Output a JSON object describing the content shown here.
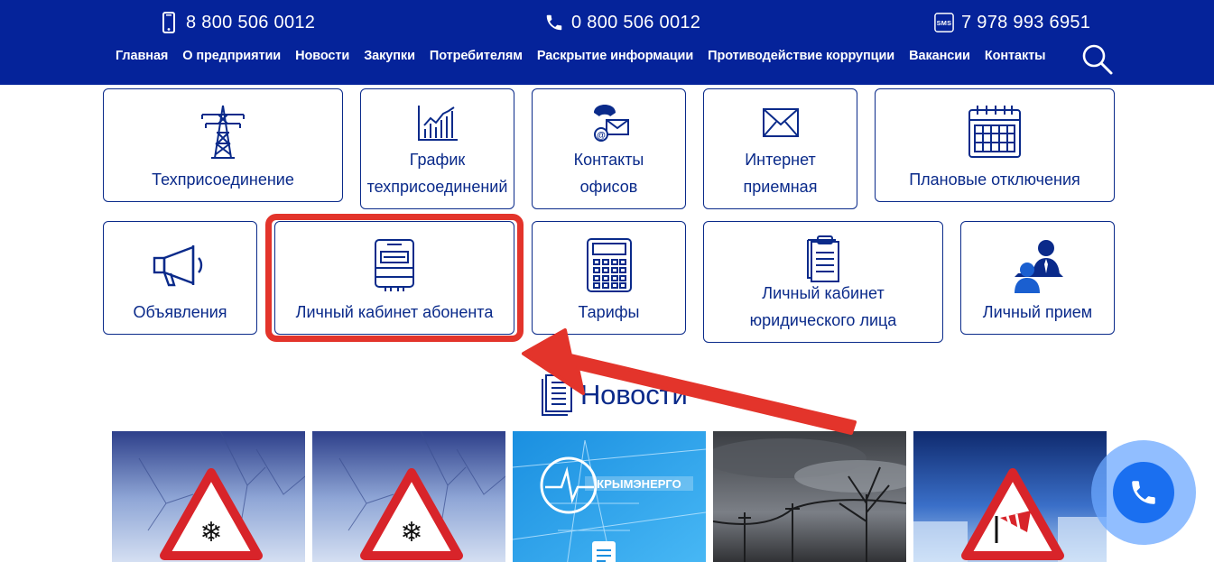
{
  "header": {
    "phones": [
      {
        "number": "8 800 506 0012",
        "icon": "mobile-phone-icon"
      },
      {
        "number": "0 800 506 0012",
        "icon": "phone-handset-icon"
      },
      {
        "number": "7 978 993 6951",
        "icon": "sms-icon",
        "icon_text": "SMS"
      }
    ],
    "nav": [
      "Главная",
      "О предприятии",
      "Новости",
      "Закупки",
      "Потребителям",
      "Раскрытие информации",
      "Противодействие коррупции",
      "Вакансии",
      "Контакты"
    ],
    "search_icon": "search-icon"
  },
  "tiles": [
    {
      "label": "Техприсоединение",
      "icon": "power-tower-icon"
    },
    {
      "label": "График техприсоединений",
      "icon": "bar-chart-icon"
    },
    {
      "label": "Контакты офисов",
      "icon": "phone-mail-icon"
    },
    {
      "label": "Интернет приемная",
      "icon": "envelope-icon"
    },
    {
      "label": "Плановые отключения",
      "icon": "calendar-icon"
    },
    {
      "label": "Объявления",
      "icon": "megaphone-icon"
    },
    {
      "label": "Личный кабинет абонента",
      "icon": "electric-meter-icon"
    },
    {
      "label": "Тарифы",
      "icon": "calculator-icon"
    },
    {
      "label": "Личный кабинет юридического лица",
      "icon": "clipboard-icon"
    },
    {
      "label": "Личный прием",
      "icon": "people-meeting-icon"
    }
  ],
  "news": {
    "title": "Новости",
    "cards": [
      {
        "image": "winter-warning-snowflake-sign"
      },
      {
        "image": "winter-warning-snowflake-sign"
      },
      {
        "image": "krymenergo-logo-banner",
        "logo_text": "КРЫМЭНЕРГО"
      },
      {
        "image": "stormy-sky-power-lines"
      },
      {
        "image": "winter-warning-wind-sign"
      }
    ]
  },
  "colors": {
    "brand_blue": "#05239a",
    "text_blue": "#0a2a8a",
    "highlight_red": "#e3342b",
    "call_blue": "#1a6ff0"
  },
  "call_button": {
    "icon": "phone-call-icon"
  }
}
